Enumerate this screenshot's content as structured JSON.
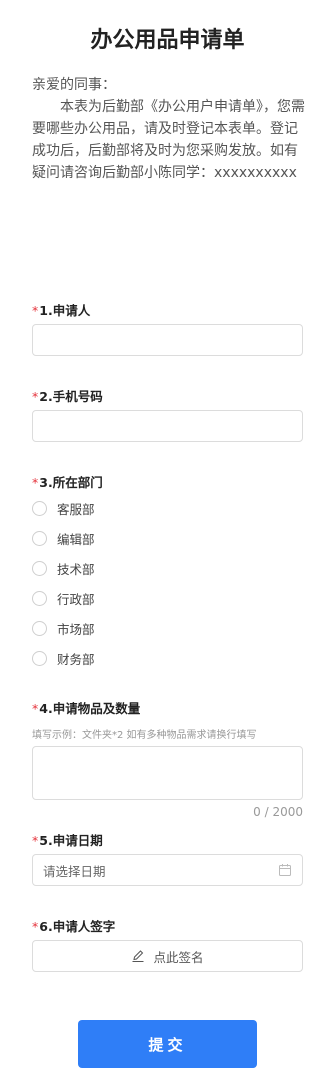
{
  "form": {
    "title": "办公用品申请单",
    "greeting": "亲爱的同事：",
    "intro": "本表为后勤部《办公用户申请单》，您需要哪些办公用品，请及时登记本表单。登记成功后，后勤部将及时为您采购发放。如有疑问请咨询后勤部小陈同学：xxxxxxxxxx"
  },
  "questions": {
    "q1": {
      "required_mark": "*",
      "label": "1.申请人",
      "value": ""
    },
    "q2": {
      "required_mark": "*",
      "label": "2.手机号码",
      "value": ""
    },
    "q3": {
      "required_mark": "*",
      "label": "3.所在部门",
      "options": [
        "客服部",
        "编辑部",
        "技术部",
        "行政部",
        "市场部",
        "财务部"
      ]
    },
    "q4": {
      "required_mark": "*",
      "label": "4.申请物品及数量",
      "hint": "填写示例：文件夹*2 如有多种物品需求请换行填写",
      "value": "",
      "counter": "0 / 2000"
    },
    "q5": {
      "required_mark": "*",
      "label": "5.申请日期",
      "placeholder": "请选择日期",
      "icon": "calendar-icon"
    },
    "q6": {
      "required_mark": "*",
      "label": "6.申请人签字",
      "button_label": "点此签名",
      "icon": "pen-icon"
    }
  },
  "submit": {
    "label": "提交",
    "color": "#2f7ef7"
  },
  "colors": {
    "required": "#e5323b",
    "border": "#dcdcdc"
  }
}
